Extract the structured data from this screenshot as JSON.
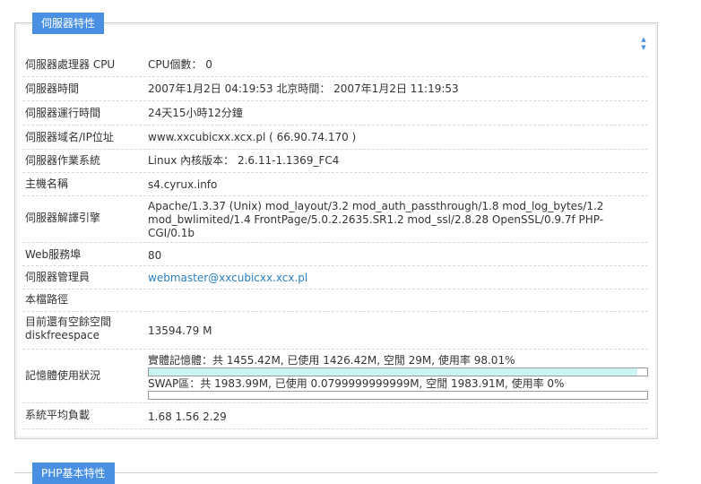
{
  "panel": {
    "title": "伺服器特性"
  },
  "rows": [
    {
      "label": "伺服器處理器 CPU",
      "value": "CPU個數： 0"
    },
    {
      "label": "伺服器時間",
      "value": "2007年1月2日 04:19:53 北京時間： 2007年1月2日 11:19:53"
    },
    {
      "label": "伺服器運行時間",
      "value": "24天15小時12分鐘"
    },
    {
      "label": "伺服器域名/IP位址",
      "value": "www.xxcubicxx.xcx.pl ( 66.90.74.170 )"
    },
    {
      "label": "伺服器作業系統",
      "value": "Linux 內核版本： 2.6.11-1.1369_FC4"
    },
    {
      "label": "主機名稱",
      "value": "s4.cyrux.info"
    },
    {
      "label": "伺服器解譯引擎",
      "value": "Apache/1.3.37 (Unix) mod_layout/3.2 mod_auth_passthrough/1.8 mod_log_bytes/1.2 mod_bwlimited/1.4 FrontPage/5.0.2.2635.SR1.2 mod_ssl/2.8.28 OpenSSL/0.9.7f PHP-CGI/0.1b"
    },
    {
      "label": "Web服務埠",
      "value": "80"
    },
    {
      "label": "伺服器管理員",
      "value": "webmaster@xxcubicxx.xcx.pl"
    },
    {
      "label": "本檔路徑",
      "value": ""
    },
    {
      "label": "目前還有空餘空間 diskfreespace",
      "value": "13594.79 M"
    },
    {
      "label": "記憶體使用狀況",
      "value": ""
    },
    {
      "label": "系統平均負載",
      "value": "1.68 1.56 2.29"
    }
  ],
  "memory": {
    "physical_caption": "實體記憶體：共 1455.42M, 已使用 1426.42M, 空閒 29M, 使用率 98.01%",
    "physical_usage_percent": 98.01,
    "swap_caption": "SWAP區：共 1983.99M, 已使用 0.0799999999999M, 空閒 1983.91M, 使用率 0%",
    "swap_usage_percent": 0,
    "bar_fill_color": "#ccf5f5"
  },
  "next_panel": {
    "title": "PHP基本特性"
  },
  "icons": {
    "scroll": "up-down-arrows-icon"
  },
  "colors": {
    "accent": "#4a90e2",
    "link": "#2a7fbf"
  }
}
